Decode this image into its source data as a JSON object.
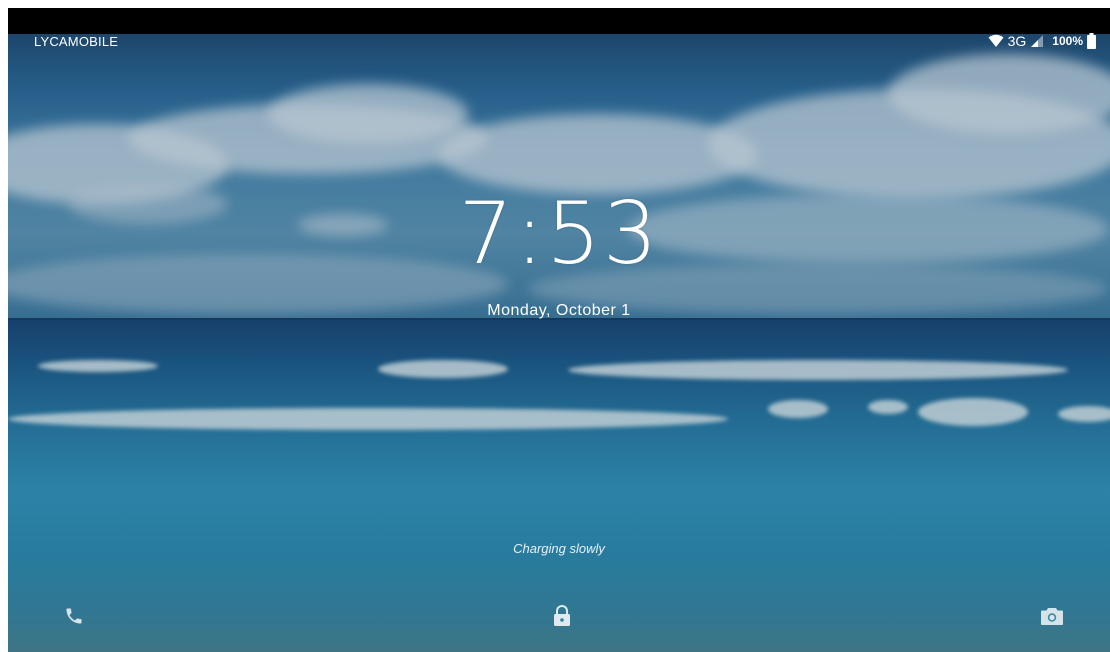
{
  "status_bar": {
    "carrier": "LYCAMOBILE",
    "network": "3G",
    "battery": "100%",
    "wifi_icon": "wifi-icon",
    "signal_icon": "cell-signal-icon",
    "battery_icon": "battery-icon"
  },
  "lockscreen": {
    "time": "7:53",
    "date": "Monday, October 1",
    "charging": "Charging slowly"
  },
  "shortcuts": {
    "left": "phone-icon",
    "center": "lock-icon",
    "right": "camera-icon"
  },
  "colors": {
    "text": "#ffffff",
    "sky": "#4d8cb4",
    "sea": "#2a7ba6"
  }
}
